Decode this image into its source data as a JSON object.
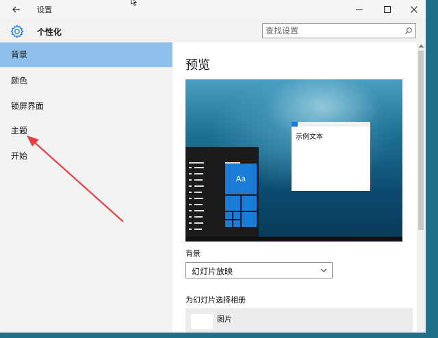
{
  "window": {
    "title": "设置",
    "header_title": "个性化",
    "search_placeholder": "查找设置"
  },
  "sidebar": {
    "items": [
      {
        "label": "背景",
        "active": true
      },
      {
        "label": "颜色",
        "active": false
      },
      {
        "label": "锁屏界面",
        "active": false
      },
      {
        "label": "主题",
        "active": false
      },
      {
        "label": "开始",
        "active": false
      }
    ]
  },
  "main": {
    "title": "预览",
    "preview": {
      "tile_text": "Aa",
      "sample_window_text": "示例文本"
    },
    "background_label": "背景",
    "background_select_value": "幻灯片放映",
    "album_label": "为幻灯片选择相册",
    "album_item_name": "图片"
  },
  "colors": {
    "accent": "#1a7cd6",
    "sidebar_selected": "#8ec1ec",
    "annotation_arrow": "#e84040"
  }
}
